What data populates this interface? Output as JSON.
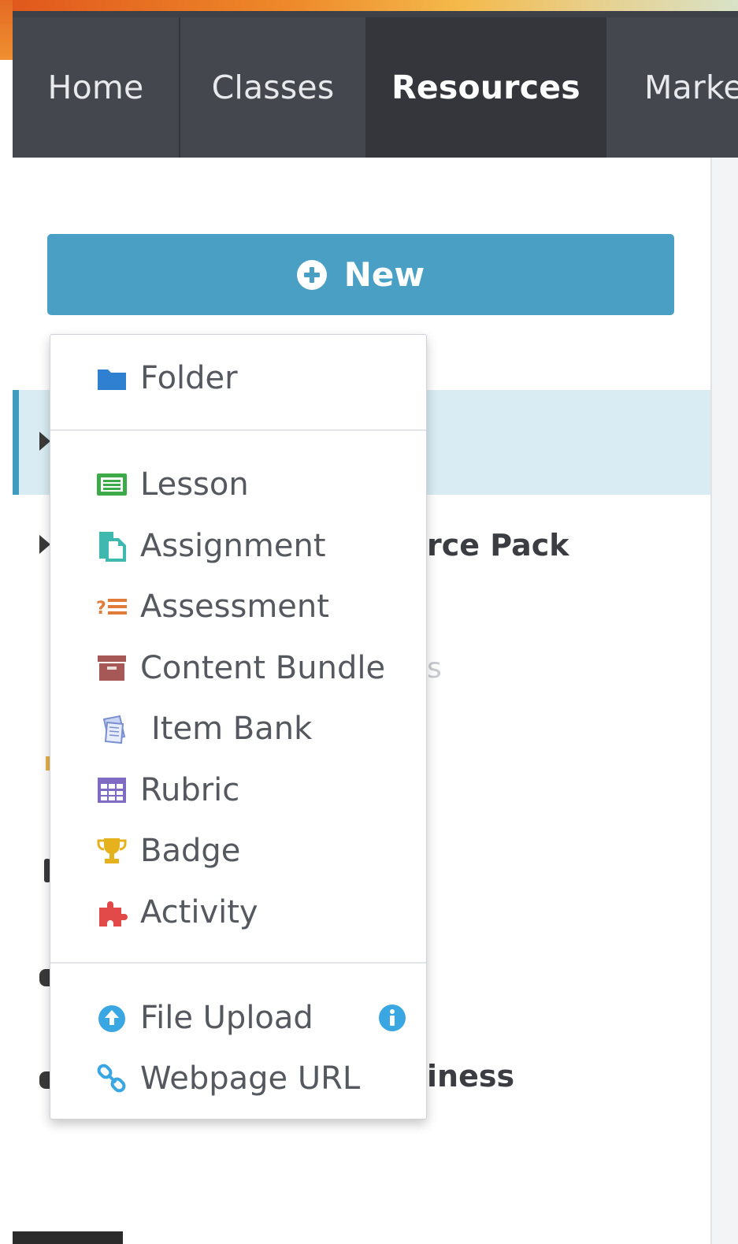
{
  "nav": {
    "tabs": [
      {
        "label": "Home"
      },
      {
        "label": "Classes"
      },
      {
        "label": "Resources"
      },
      {
        "label": "Marke"
      }
    ]
  },
  "new_button": {
    "label": "New"
  },
  "background_list": {
    "row2_visible": "rce Pack",
    "row3_visible": "s",
    "row4_visible": "iness"
  },
  "dropdown": {
    "items": [
      {
        "label": "Folder",
        "icon": "folder-icon",
        "color": "#2f80d1"
      },
      {
        "label": "Lesson",
        "icon": "lesson-icon",
        "color": "#3daa49"
      },
      {
        "label": "Assignment",
        "icon": "assignment-icon",
        "color": "#3fb8b0"
      },
      {
        "label": "Assessment",
        "icon": "assessment-icon",
        "color": "#e27a38"
      },
      {
        "label": "Content Bundle",
        "icon": "archive-box-icon",
        "color": "#a55856"
      },
      {
        "label": "Item Bank",
        "icon": "item-bank-icon",
        "color": "#7a8fd0"
      },
      {
        "label": "Rubric",
        "icon": "table-grid-icon",
        "color": "#7f6bc4"
      },
      {
        "label": "Badge",
        "icon": "trophy-icon",
        "color": "#e5b21d"
      },
      {
        "label": "Activity",
        "icon": "puzzle-icon",
        "color": "#e24a4a"
      },
      {
        "label": "File Upload",
        "icon": "upload-icon",
        "color": "#3aa7e3"
      },
      {
        "label": "Webpage URL",
        "icon": "link-icon",
        "color": "#3aa7e3"
      }
    ]
  },
  "colors": {
    "nav_bg": "#45474f",
    "nav_active_bg": "#34363c",
    "accent": "#4aa0c4",
    "selected_row": "#d9ecf3"
  }
}
